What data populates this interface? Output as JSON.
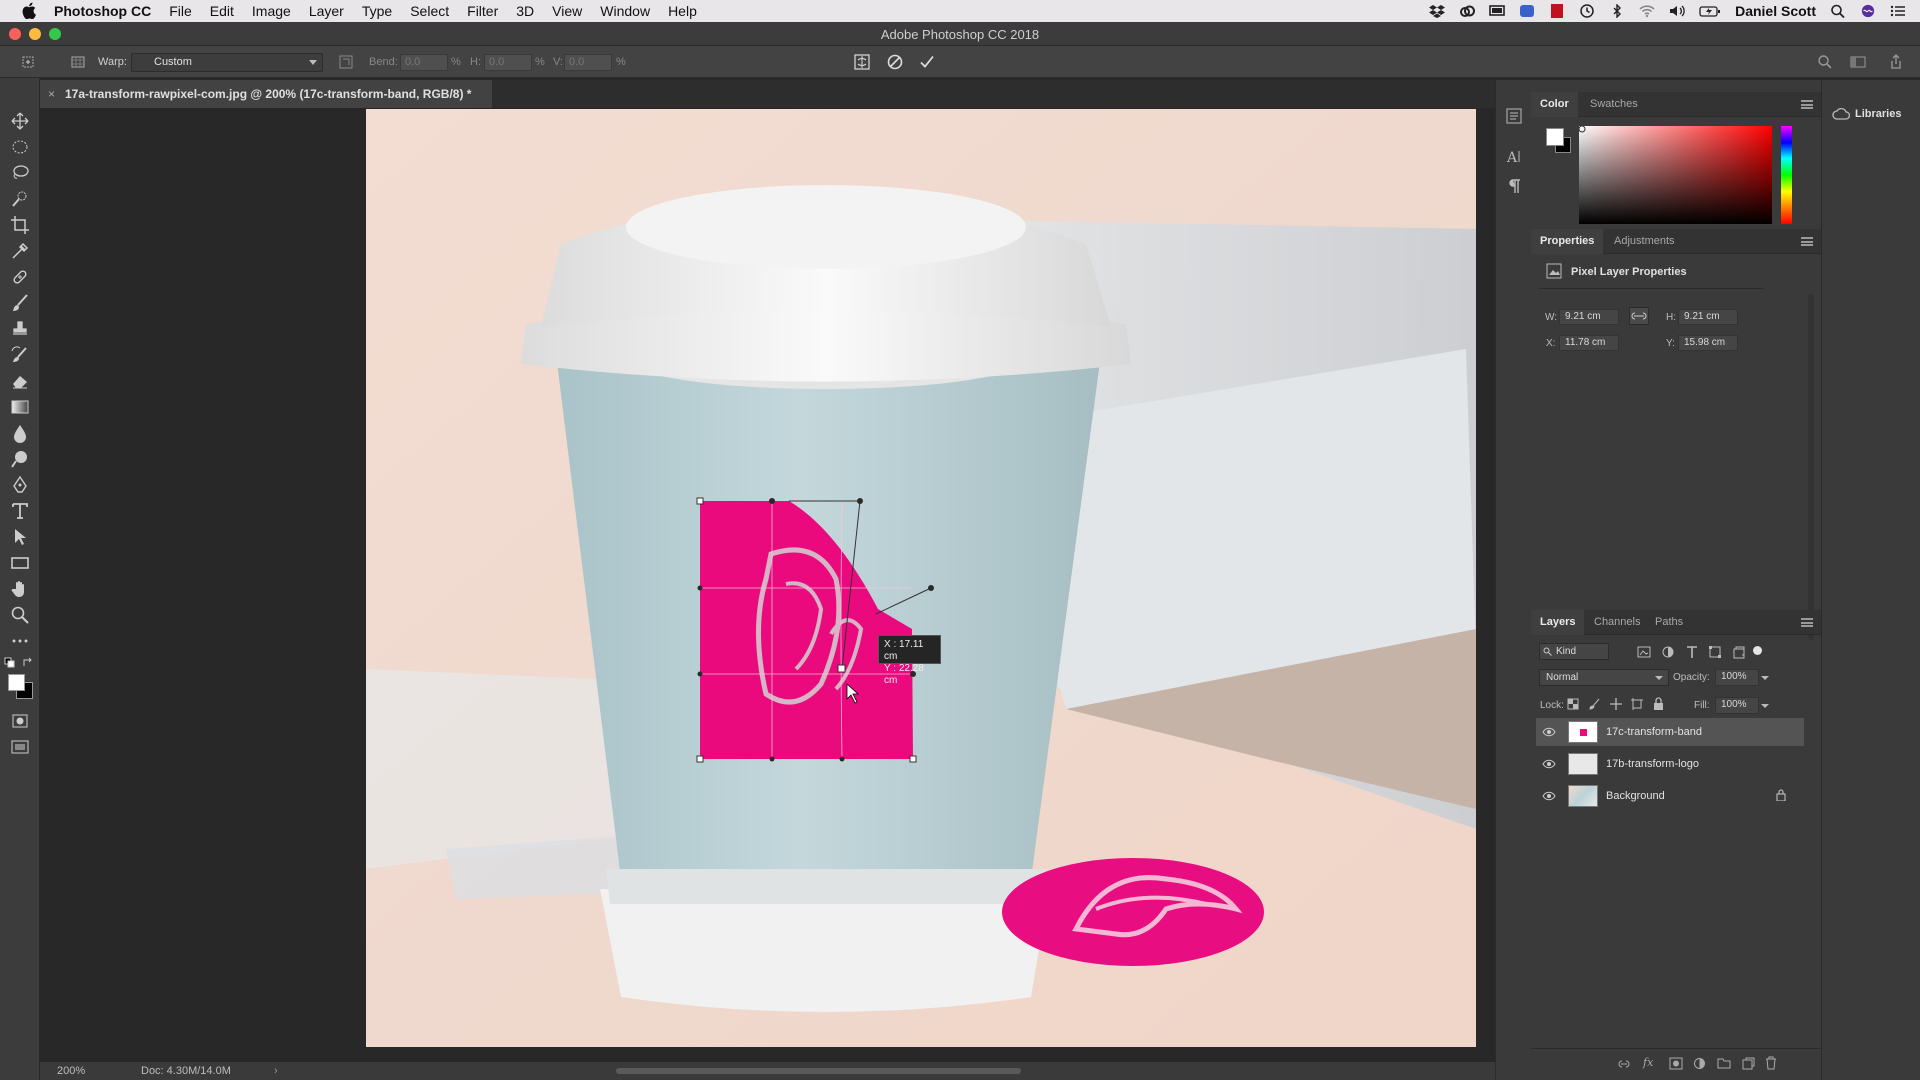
{
  "menubar": {
    "app_name": "Photoshop CC",
    "items": [
      "File",
      "Edit",
      "Image",
      "Layer",
      "Type",
      "Select",
      "Filter",
      "3D",
      "View",
      "Window",
      "Help"
    ],
    "user": "Daniel Scott"
  },
  "window": {
    "title": "Adobe Photoshop CC 2018"
  },
  "options_bar": {
    "warp_label": "Warp:",
    "warp_value": "Custom",
    "bend_label": "Bend:",
    "bend_value": "0.0",
    "bend_unit": "%",
    "h_label": "H:",
    "h_value": "0.0",
    "h_unit": "%",
    "v_label": "V:",
    "v_value": "0.0",
    "v_unit": "%"
  },
  "document": {
    "tab_title": "17a-transform-rawpixel-com.jpg @ 200% (17c-transform-band, RGB/8) *",
    "tooltip_x": "X :  17.11 cm",
    "tooltip_y": "Y : 22.28 cm"
  },
  "status": {
    "zoom": "200%",
    "doc_size": "Doc: 4.30M/14.0M"
  },
  "color_panel": {
    "tabs": [
      "Color",
      "Swatches"
    ]
  },
  "properties_panel": {
    "tabs": [
      "Properties",
      "Adjustments"
    ],
    "heading": "Pixel Layer Properties",
    "w_label": "W:",
    "w_value": "9.21 cm",
    "h_label": "H:",
    "h_value": "9.21 cm",
    "x_label": "X:",
    "x_value": "11.78 cm",
    "y_label": "Y:",
    "y_value": "15.98 cm"
  },
  "layers_panel": {
    "tabs": [
      "Layers",
      "Channels",
      "Paths"
    ],
    "filter_kind": "Kind",
    "blend_mode": "Normal",
    "opacity_label": "Opacity:",
    "opacity_value": "100%",
    "lock_label": "Lock:",
    "fill_label": "Fill:",
    "fill_value": "100%",
    "layers": [
      {
        "name": "17c-transform-band",
        "selected": true
      },
      {
        "name": "17b-transform-logo",
        "selected": false
      },
      {
        "name": "Background",
        "selected": false
      }
    ]
  },
  "libraries": {
    "label": "Libraries"
  },
  "colors": {
    "accent_pink": "#ea0a7e",
    "cup_blue": "#bcd3d8"
  }
}
